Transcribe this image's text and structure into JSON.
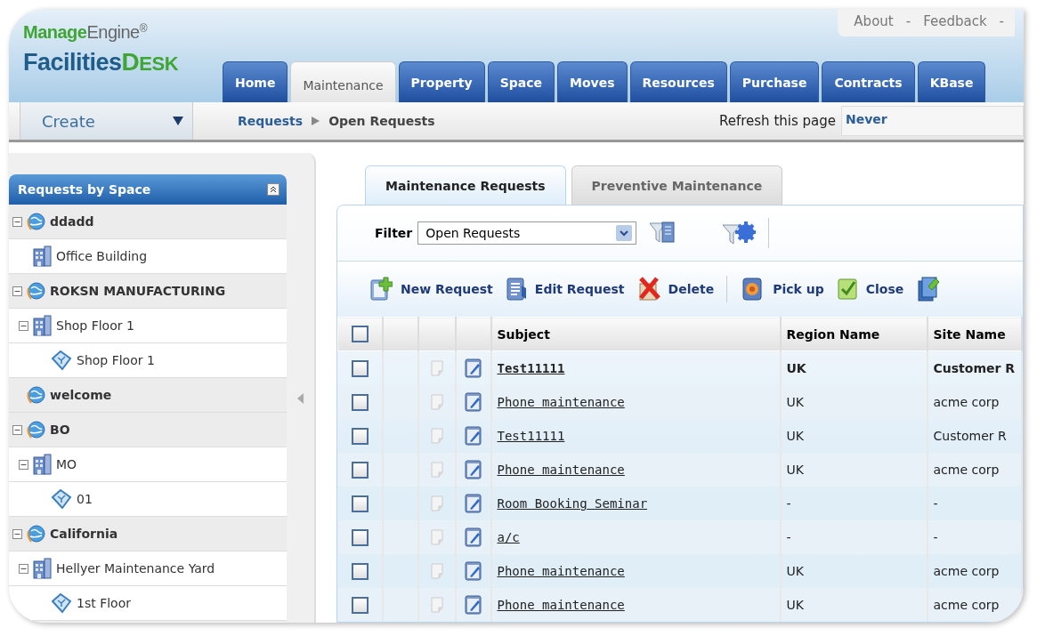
{
  "header": {
    "logo": {
      "brand_a": "Manage",
      "brand_b": "Engine",
      "reg": "®",
      "product_a": "Facilities",
      "product_b": "DESK"
    },
    "links": [
      "About",
      "Feedback"
    ],
    "link_separator": "-",
    "tabs": [
      {
        "label": "Home",
        "selected": false
      },
      {
        "label": "Maintenance",
        "selected": true
      },
      {
        "label": "Property",
        "selected": false
      },
      {
        "label": "Space",
        "selected": false
      },
      {
        "label": "Moves",
        "selected": false
      },
      {
        "label": "Resources",
        "selected": false
      },
      {
        "label": "Purchase",
        "selected": false
      },
      {
        "label": "Contracts",
        "selected": false
      },
      {
        "label": "KBase",
        "selected": false
      }
    ]
  },
  "subbar": {
    "create": "Create",
    "breadcrumb": [
      "Requests",
      "Open Requests"
    ],
    "refresh_label": "Refresh this page",
    "refresh_value": "Never"
  },
  "sidebar": {
    "title": "Requests by Space",
    "tree": [
      {
        "label": "ddadd",
        "kind": "site",
        "expanded": true,
        "children": [
          {
            "label": "Office Building",
            "kind": "building"
          }
        ]
      },
      {
        "label": "ROKSN MANUFACTURING",
        "kind": "site",
        "expanded": true,
        "children": [
          {
            "label": "Shop Floor 1",
            "kind": "building",
            "expanded": true,
            "children": [
              {
                "label": "Shop Floor 1",
                "kind": "floor"
              }
            ]
          }
        ]
      },
      {
        "label": "welcome",
        "kind": "site"
      },
      {
        "label": "BO",
        "kind": "site",
        "expanded": true,
        "children": [
          {
            "label": "MO",
            "kind": "building",
            "expanded": true,
            "children": [
              {
                "label": "01",
                "kind": "floor"
              }
            ]
          }
        ]
      },
      {
        "label": "California",
        "kind": "site",
        "expanded": true,
        "children": [
          {
            "label": "Hellyer Maintenance Yard",
            "kind": "building",
            "expanded": true,
            "children": [
              {
                "label": "1st Floor",
                "kind": "floor"
              }
            ]
          }
        ]
      }
    ]
  },
  "content": {
    "tabs": [
      {
        "label": "Maintenance Requests",
        "selected": true
      },
      {
        "label": "Preventive Maintenance",
        "selected": false
      }
    ],
    "filter": {
      "label": "Filter",
      "value": "Open Requests"
    },
    "toolbar": [
      {
        "kind": "new",
        "label": "New Request"
      },
      {
        "kind": "edit",
        "label": "Edit Request"
      },
      {
        "kind": "delete",
        "label": "Delete"
      },
      {
        "kind": "separator"
      },
      {
        "kind": "pickup",
        "label": "Pick up"
      },
      {
        "kind": "close",
        "label": "Close"
      },
      {
        "kind": "book"
      }
    ],
    "table": {
      "select_all_checked": false,
      "columns": [
        "Subject",
        "Region Name",
        "Site Name"
      ],
      "rows": [
        {
          "checked": false,
          "unread": true,
          "subject": "Test11111",
          "region": "UK",
          "site": "Customer R"
        },
        {
          "checked": false,
          "unread": false,
          "subject": "Phone maintenance",
          "region": "UK",
          "site": "acme corp"
        },
        {
          "checked": false,
          "unread": false,
          "subject": "Test11111",
          "region": "UK",
          "site": "Customer R"
        },
        {
          "checked": false,
          "unread": false,
          "subject": "Phone maintenance",
          "region": "UK",
          "site": "acme corp"
        },
        {
          "checked": false,
          "unread": false,
          "subject": "Room Booking Seminar",
          "region": "-",
          "site": "-"
        },
        {
          "checked": false,
          "unread": false,
          "subject": "a/c",
          "region": "-",
          "site": "-"
        },
        {
          "checked": false,
          "unread": false,
          "subject": "Phone maintenance",
          "region": "UK",
          "site": "acme corp"
        },
        {
          "checked": false,
          "unread": false,
          "subject": "Phone maintenance",
          "region": "UK",
          "site": "acme corp"
        }
      ]
    }
  }
}
